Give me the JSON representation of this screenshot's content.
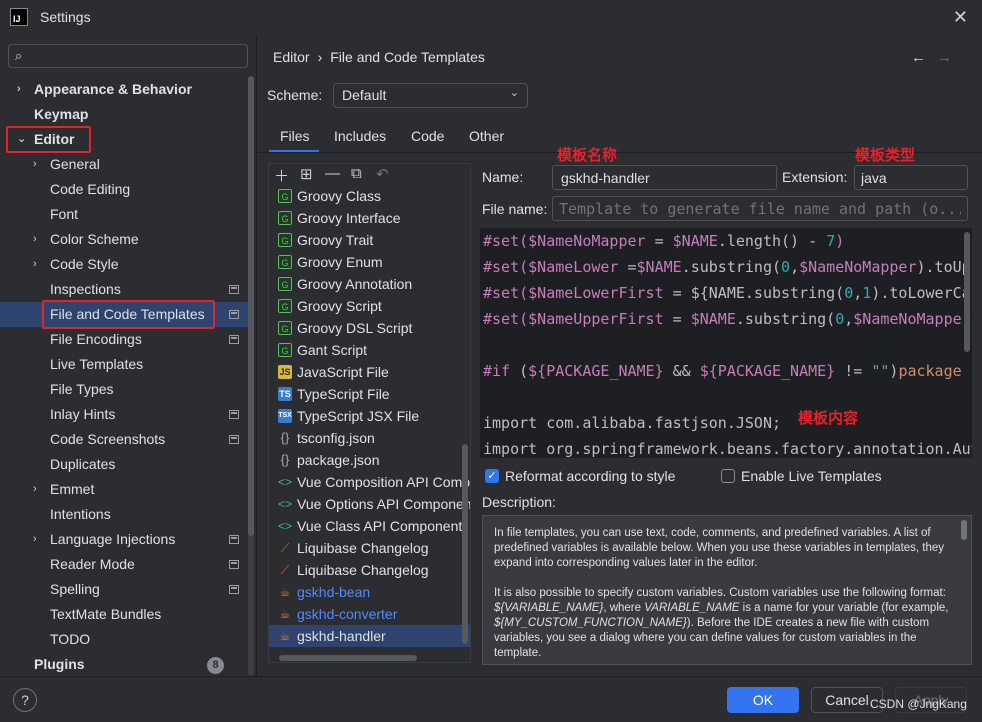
{
  "window": {
    "title": "Settings",
    "app_icon": "IJ"
  },
  "search": {
    "placeholder": ""
  },
  "sidebar": {
    "items": [
      {
        "label": "Appearance & Behavior"
      },
      {
        "label": "Keymap"
      },
      {
        "label": "Editor"
      },
      {
        "label": "General"
      },
      {
        "label": "Code Editing"
      },
      {
        "label": "Font"
      },
      {
        "label": "Color Scheme"
      },
      {
        "label": "Code Style"
      },
      {
        "label": "Inspections"
      },
      {
        "label": "File and Code Templates"
      },
      {
        "label": "File Encodings"
      },
      {
        "label": "Live Templates"
      },
      {
        "label": "File Types"
      },
      {
        "label": "Inlay Hints"
      },
      {
        "label": "Code Screenshots"
      },
      {
        "label": "Duplicates"
      },
      {
        "label": "Emmet"
      },
      {
        "label": "Intentions"
      },
      {
        "label": "Language Injections"
      },
      {
        "label": "Reader Mode"
      },
      {
        "label": "Spelling"
      },
      {
        "label": "TextMate Bundles"
      },
      {
        "label": "TODO"
      },
      {
        "label": "Plugins"
      }
    ],
    "plugins_badge": "8"
  },
  "breadcrumb": {
    "part1": "Editor",
    "separator": "›",
    "part2": "File and Code Templates"
  },
  "scheme": {
    "label": "Scheme:",
    "value": "Default"
  },
  "tabs": [
    {
      "label": "Files"
    },
    {
      "label": "Includes"
    },
    {
      "label": "Code"
    },
    {
      "label": "Other"
    }
  ],
  "templates": [
    {
      "icon": "G",
      "label": "Groovy Class"
    },
    {
      "icon": "G",
      "label": "Groovy Interface"
    },
    {
      "icon": "G",
      "label": "Groovy Trait"
    },
    {
      "icon": "G",
      "label": "Groovy Enum"
    },
    {
      "icon": "G",
      "label": "Groovy Annotation"
    },
    {
      "icon": "G",
      "label": "Groovy Script"
    },
    {
      "icon": "G",
      "label": "Groovy DSL Script"
    },
    {
      "icon": "G",
      "label": "Gant Script"
    },
    {
      "icon": "JS",
      "label": "JavaScript File"
    },
    {
      "icon": "TS",
      "label": "TypeScript File"
    },
    {
      "icon": "TSX",
      "label": "TypeScript JSX File"
    },
    {
      "icon": "{}",
      "label": "tsconfig.json"
    },
    {
      "icon": "{}",
      "label": "package.json"
    },
    {
      "icon": "<>",
      "label": "Vue Composition API Component"
    },
    {
      "icon": "<>",
      "label": "Vue Options API Component"
    },
    {
      "icon": "<>",
      "label": "Vue Class API Component"
    },
    {
      "icon": "⟋",
      "label": "Liquibase Changelog"
    },
    {
      "icon": "⟋",
      "label": "Liquibase Changelog"
    },
    {
      "icon": "☕",
      "label": "gskhd-bean"
    },
    {
      "icon": "☕",
      "label": "gskhd-converter"
    },
    {
      "icon": "☕",
      "label": "gskhd-handler"
    }
  ],
  "form": {
    "name_label": "Name:",
    "name_value": "gskhd-handler",
    "extension_label": "Extension:",
    "extension_value": "java",
    "filename_label": "File name:",
    "filename_placeholder": "Template to generate file name and path (o..."
  },
  "annotations": {
    "template_name": "模板名称",
    "template_type": "模板类型",
    "template_content": "模板内容"
  },
  "editor": {
    "line1": {
      "a": "#set(",
      "b": "$NameNoMapper",
      "c": " = ",
      "d": "$NAME",
      "e": ".length() - ",
      "f": "7",
      "g": ")"
    },
    "line2": {
      "a": "#set(",
      "b": "$NameLower",
      "c": " =",
      "d": "$NAME",
      "e": ".substring(",
      "f": "0",
      "g": ",",
      "h": "$NameNoMapper",
      "i": ").toUpp"
    },
    "line3": {
      "a": "#set(",
      "b": "$NameLowerFirst",
      "c": " = ${",
      "d": "NAME.substring(",
      "e": "0",
      "f": ",",
      "g": "1",
      "h": ").toLowerCa"
    },
    "line4": {
      "a": "#set(",
      "b": "$NameUpperFirst",
      "c": " = ",
      "d": "$NAME",
      "e": ".substring(",
      "f": "0",
      "g": ",",
      "h": "$NameNoMapper"
    },
    "line5": {
      "a": "#if",
      "b": " (",
      "c": "${PACKAGE_NAME}",
      "d": " && ",
      "e": "${PACKAGE_NAME}",
      "f": " != ",
      "g": "\"\"",
      "h": ")",
      "i": "package $"
    },
    "line6": {
      "a": "import com.alibaba.fastjson.JSON;"
    },
    "line7": {
      "a": "import org.springframework.beans.factory.annotation.Aut"
    }
  },
  "options": {
    "reformat_label": "Reformat according to style",
    "live_label": "Enable Live Templates"
  },
  "description": {
    "label": "Description:",
    "p1": "In file templates, you can use text, code, comments, and predefined variables. A list of predefined variables is available below. When you use these variables in templates, they expand into corresponding values later in the editor.",
    "p2a": "It is also possible to specify custom variables. Custom variables use the following format: ",
    "p2b": "${VARIABLE_NAME}",
    "p2c": ", where ",
    "p2d": "VARIABLE_NAME",
    "p2e": " is a name for your variable (for example, ",
    "p2f": "${MY_CUSTOM_FUNCTION_NAME}",
    "p2g": "). Before the IDE creates a new file with custom variables, you see a dialog where you can define values for custom variables in the template."
  },
  "footer": {
    "help": "?",
    "ok": "OK",
    "cancel": "Cancel",
    "apply": "Apply",
    "watermark": "CSDN @JngKang"
  },
  "colors": {
    "accent": "#3574f0",
    "annotation": "#e5212c",
    "selection": "#2e436e"
  }
}
